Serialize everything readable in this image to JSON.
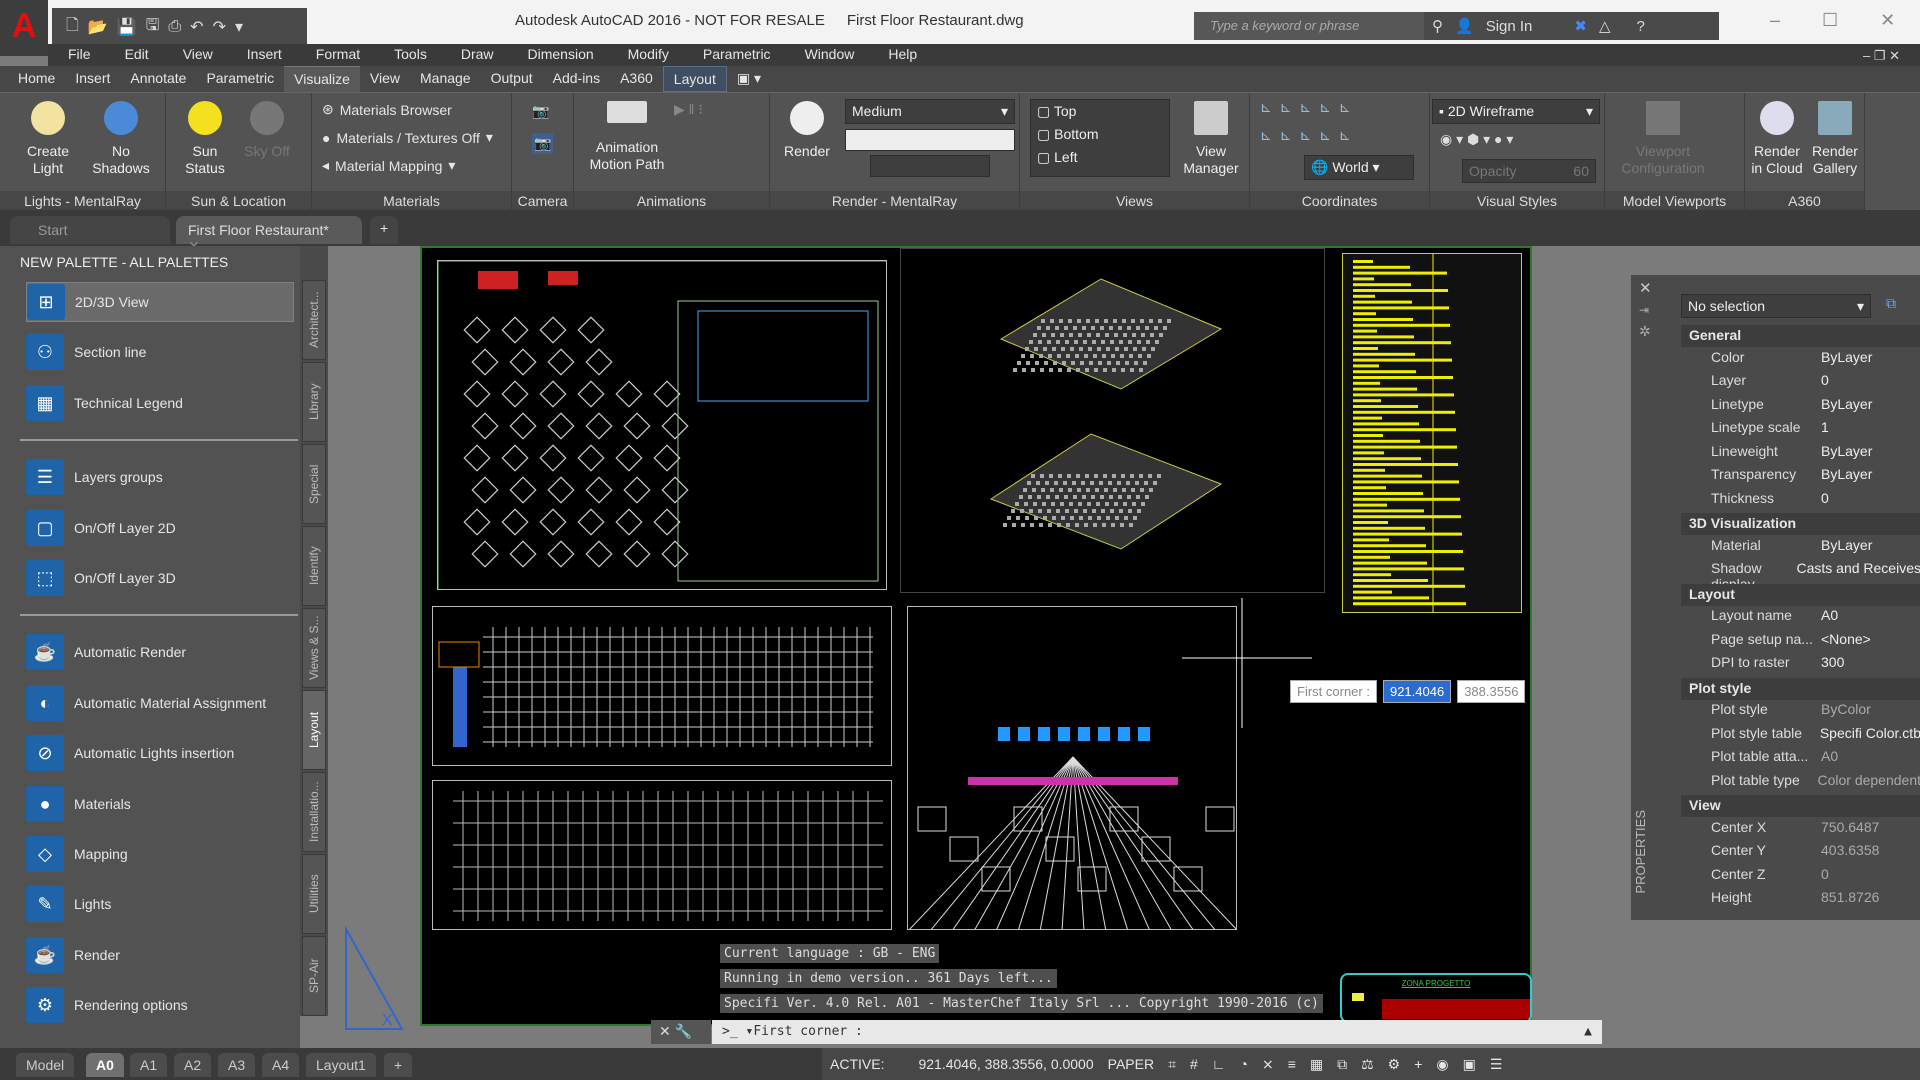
{
  "titlebar": {
    "app_title": "Autodesk AutoCAD 2016 - NOT FOR RESALE",
    "file": "First Floor Restaurant.dwg",
    "search_placeholder": "Type a keyword or phrase",
    "sign_in": "Sign In"
  },
  "menu": [
    "File",
    "Edit",
    "View",
    "Insert",
    "Format",
    "Tools",
    "Draw",
    "Dimension",
    "Modify",
    "Parametric",
    "Window",
    "Help"
  ],
  "ribbon_tabs": [
    "Home",
    "Insert",
    "Annotate",
    "Parametric",
    "Visualize",
    "View",
    "Manage",
    "Output",
    "Add-ins",
    "A360",
    "Layout"
  ],
  "active_tab": "Visualize",
  "ribbon": {
    "lights": {
      "title": "Lights - MentalRay",
      "create_light": "Create Light",
      "no_shadows": "No Shadows"
    },
    "sun": {
      "title": "Sun & Location",
      "sun_status": "Sun Status",
      "sky_off": "Sky Off"
    },
    "materials": {
      "title": "Materials",
      "browser": "Materials Browser",
      "textures": "Materials / Textures Off",
      "mapping": "Material Mapping"
    },
    "camera": {
      "title": "Camera"
    },
    "animations": {
      "title": "Animations",
      "motion_path": "Animation Motion Path"
    },
    "render": {
      "title": "Render - MentalRay",
      "render": "Render",
      "quality": "Medium"
    },
    "views": {
      "title": "Views",
      "items": [
        "Top",
        "Bottom",
        "Left"
      ],
      "view_manager": "View Manager"
    },
    "coordinates": {
      "title": "Coordinates",
      "ucs": "World"
    },
    "visual_styles": {
      "title": "Visual Styles",
      "style": "2D Wireframe",
      "opacity_label": "Opacity",
      "opacity_value": "60"
    },
    "model_viewports": {
      "title": "Model Viewports",
      "config": "Viewport Configuration"
    },
    "a360": {
      "title": "A360",
      "render_cloud": "Render in Cloud",
      "render_gallery": "Render Gallery"
    }
  },
  "doc_tabs": {
    "start": "Start",
    "active": "First Floor Restaurant*"
  },
  "palette": {
    "title": "NEW PALETTE - ALL PALETTES",
    "group1": [
      "2D/3D View",
      "Section line",
      "Technical Legend"
    ],
    "group2": [
      "Layers groups",
      "On/Off Layer 2D",
      "On/Off Layer 3D"
    ],
    "group3": [
      "Automatic Render",
      "Automatic Material Assignment",
      "Automatic Lights insertion",
      "Materials",
      "Mapping",
      "Lights",
      "Render",
      "Rendering options"
    ],
    "side_tabs": [
      "Architect...",
      "Library",
      "Special",
      "Identify",
      "Views & S...",
      "Layout",
      "Installatio...",
      "Utilities",
      "SP-Air"
    ],
    "active_side_tab": "Layout"
  },
  "dynamic_input": {
    "label": "First corner :",
    "x": "921.4046",
    "y": "388.3556"
  },
  "command": {
    "history": [
      "Current language : GB - ENG",
      "Running in demo version.. 361 Days left...",
      "Specifi Ver. 4.0 Rel. A01 -  MasterChef Italy Srl ...  Copyright 1990-2016 (c)"
    ],
    "prompt": "First corner :"
  },
  "properties": {
    "selection": "No selection",
    "panel_label": "PROPERTIES",
    "sections": [
      {
        "title": "General",
        "rows": [
          [
            "Color",
            "ByLayer"
          ],
          [
            "Layer",
            "0"
          ],
          [
            "Linetype",
            "ByLayer"
          ],
          [
            "Linetype scale",
            "1"
          ],
          [
            "Lineweight",
            "ByLayer"
          ],
          [
            "Transparency",
            "ByLayer"
          ],
          [
            "Thickness",
            "0"
          ]
        ]
      },
      {
        "title": "3D Visualization",
        "rows": [
          [
            "Material",
            "ByLayer"
          ],
          [
            "Shadow display",
            "Casts and Receives"
          ]
        ]
      },
      {
        "title": "Layout",
        "rows": [
          [
            "Layout name",
            "A0"
          ],
          [
            "Page setup na...",
            "<None>"
          ],
          [
            "DPI to raster",
            "300"
          ]
        ]
      },
      {
        "title": "Plot style",
        "rows": [
          [
            "Plot style",
            "ByColor"
          ],
          [
            "Plot style table",
            "Specifi Color.ctb"
          ],
          [
            "Plot table atta...",
            "A0"
          ],
          [
            "Plot table type",
            "Color dependent"
          ]
        ]
      },
      {
        "title": "View",
        "rows": [
          [
            "Center X",
            "750.6487"
          ],
          [
            "Center Y",
            "403.6358"
          ],
          [
            "Center Z",
            "0"
          ],
          [
            "Height",
            "851.8726"
          ]
        ]
      }
    ]
  },
  "layout_tabs": [
    "Model",
    "A0",
    "A1",
    "A2",
    "A3",
    "A4",
    "Layout1"
  ],
  "active_layout": "A0",
  "statusbar": {
    "active": "ACTIVE:",
    "coords": "921.4046, 388.3556, 0.0000",
    "space": "PAPER"
  },
  "title_block_text": "ZONA PROGETTO"
}
